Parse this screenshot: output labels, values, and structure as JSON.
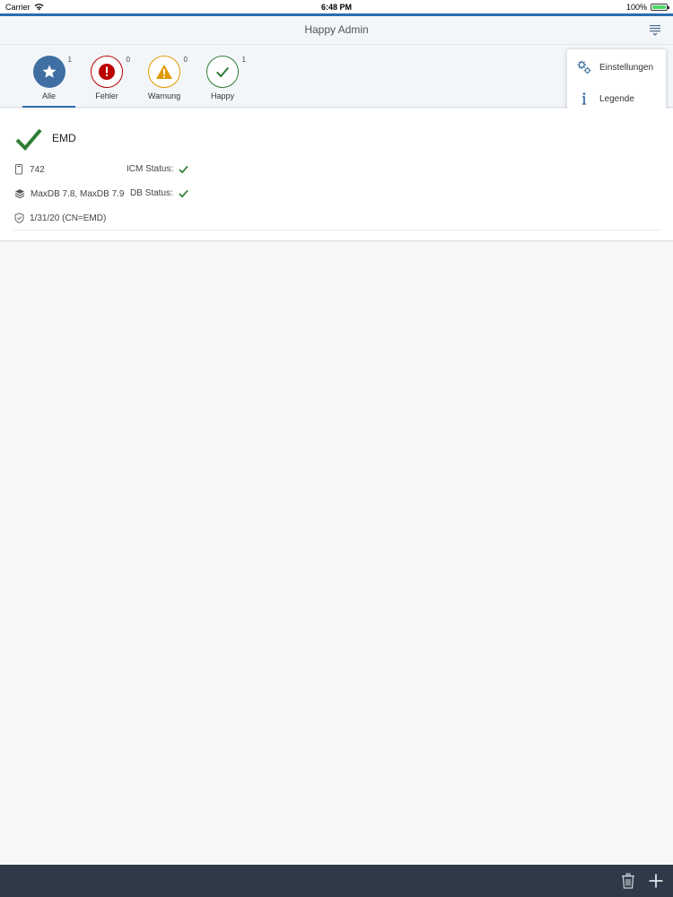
{
  "statusbar": {
    "carrier": "Carrier",
    "time": "6:48 PM",
    "battery": "100%",
    "battery_level": 1.0
  },
  "header": {
    "title": "Happy Admin"
  },
  "filters": [
    {
      "label": "Alle",
      "count": "1"
    },
    {
      "label": "Fehler",
      "count": "0"
    },
    {
      "label": "Warnung",
      "count": "0"
    },
    {
      "label": "Happy",
      "count": "1"
    }
  ],
  "menu": {
    "items": [
      {
        "label": "Einstellungen",
        "icon": "gears-icon"
      },
      {
        "label": "Legende",
        "icon": "info-icon"
      }
    ]
  },
  "system": {
    "name": "EMD",
    "release": "742",
    "icm_label": "ICM Status:",
    "db": "MaxDB 7.8, MaxDB 7.9",
    "db_label": "DB Status:",
    "cert": "1/31/20 (CN=EMD)"
  },
  "colors": {
    "accent": "#2b6cb0",
    "ok": "#2e7d32",
    "error": "#bb0000",
    "warning": "#e09a00",
    "footer": "#2e3a47"
  }
}
